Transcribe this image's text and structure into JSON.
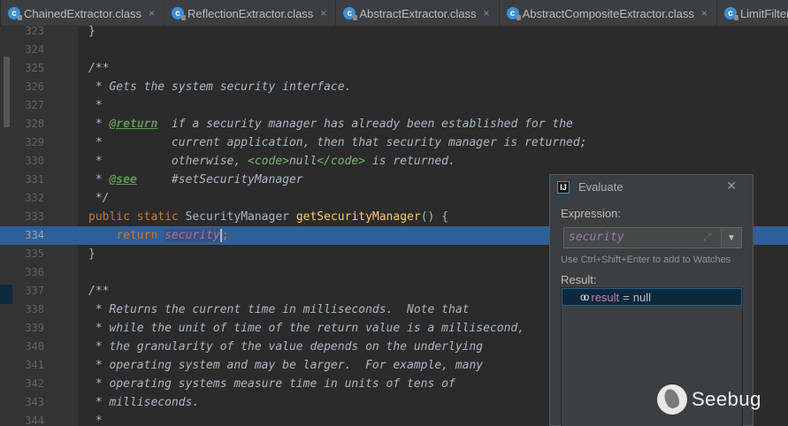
{
  "tabs": [
    {
      "label": "ChainedExtractor.class",
      "close": "×",
      "icon": "c"
    },
    {
      "label": "ReflectionExtractor.class",
      "close": "×",
      "icon": "c"
    },
    {
      "label": "AbstractExtractor.class",
      "close": "×",
      "icon": "c"
    },
    {
      "label": "AbstractCompositeExtractor.class",
      "close": "×",
      "icon": "c"
    },
    {
      "label": "LimitFilter",
      "close": "",
      "icon": "c"
    }
  ],
  "editor": {
    "lines": [
      {
        "n": "323"
      },
      {
        "n": "324"
      },
      {
        "n": "325"
      },
      {
        "n": "326"
      },
      {
        "n": "327"
      },
      {
        "n": "328"
      },
      {
        "n": "329"
      },
      {
        "n": "330"
      },
      {
        "n": "331"
      },
      {
        "n": "332"
      },
      {
        "n": "333"
      },
      {
        "n": "334"
      },
      {
        "n": "335"
      },
      {
        "n": "336"
      },
      {
        "n": "337"
      },
      {
        "n": "338"
      },
      {
        "n": "339"
      },
      {
        "n": "340"
      },
      {
        "n": "341"
      },
      {
        "n": "342"
      },
      {
        "n": "343"
      },
      {
        "n": "344"
      }
    ],
    "code": {
      "l323": "}",
      "l325": "/**",
      "l326": " * Gets the system security interface.",
      "l327": " *",
      "l328_a": " * ",
      "l328_tag": "@return",
      "l328_b": "  if a security manager has already been established for the",
      "l329": " *          current application, then that security manager is returned;",
      "l330_a": " *          otherwise, ",
      "l330_open": "<code>",
      "l330_null": "null",
      "l330_close": "</code>",
      "l330_b": " is returned.",
      "l331_a": " * ",
      "l331_tag": "@see",
      "l331_b": "     #setSecurityManager",
      "l332": " */",
      "l333_kw": "public static ",
      "l333_type": "SecurityManager ",
      "l333_fn": "getSecurityManager",
      "l333_rest": "() {",
      "l334_kw": "    return ",
      "l334_field": "security",
      "l334_semi": ";",
      "l335": "}",
      "l337": "/**",
      "l338": " * Returns the current time in milliseconds.  Note that",
      "l339": " * while the unit of time of the return value is a millisecond,",
      "l340": " * the granularity of the value depends on the underlying",
      "l341": " * operating system and may be larger.  For example, many",
      "l342": " * operating systems measure time in units of tens of",
      "l343": " * milliseconds.",
      "l344": " *"
    }
  },
  "evaluate": {
    "title": "Evaluate",
    "close": "✕",
    "logo": "IJ",
    "expression_label": "Expression:",
    "expression_value": "security",
    "expand_icon": "⤢",
    "dropdown_arrow": "▼",
    "hint": "Use Ctrl+Shift+Enter to add to Watches",
    "result_label": "Result:",
    "result_icon": "oo",
    "result_name": "result",
    "result_eq": "=",
    "result_value": "null"
  },
  "watermark": {
    "text": "Seebug"
  },
  "colors": {
    "background": "#2b2b2b",
    "gutter": "#313335",
    "selection": "#2d6099",
    "comment": "#629755",
    "keyword": "#cc7832",
    "method": "#ffc66d",
    "field": "#9876aa"
  }
}
